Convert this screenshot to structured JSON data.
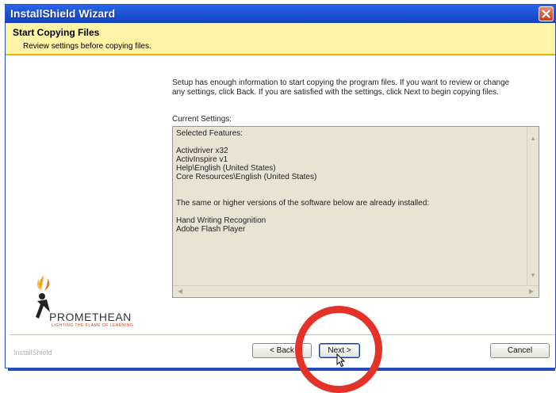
{
  "window": {
    "title": "InstallShield Wizard",
    "close_icon": "close-icon"
  },
  "header": {
    "title": "Start Copying Files",
    "subtitle": "Review settings before copying files."
  },
  "main": {
    "intro_line1": "Setup has enough information to start copying the program files.  If you want to review or change",
    "intro_line2": "any settings, click Back.  If you are satisfied with the settings, click Next to begin copying files.",
    "settings_label": "Current Settings:",
    "settings_lines": [
      "Selected Features:",
      "",
      "Activdriver x32",
      "ActivInspire v1",
      "Help\\English (United States)",
      "Core Resources\\English (United States)",
      "",
      "",
      "The same or higher versions of the software below are already installed:",
      "",
      "Hand Writing Recognition",
      "Adobe Flash Player"
    ]
  },
  "branding": {
    "logo_text": "PROMETHEAN",
    "tagline": "LIGHTING THE FLAME OF LEARNING"
  },
  "footer": {
    "brand": "InstallShield",
    "back_label": "< Back",
    "next_label": "Next >",
    "cancel_label": "Cancel"
  },
  "colors": {
    "titlebar": "#1f55d8",
    "header_bg": "#fff3a6",
    "highlight_circle": "#e53228"
  }
}
